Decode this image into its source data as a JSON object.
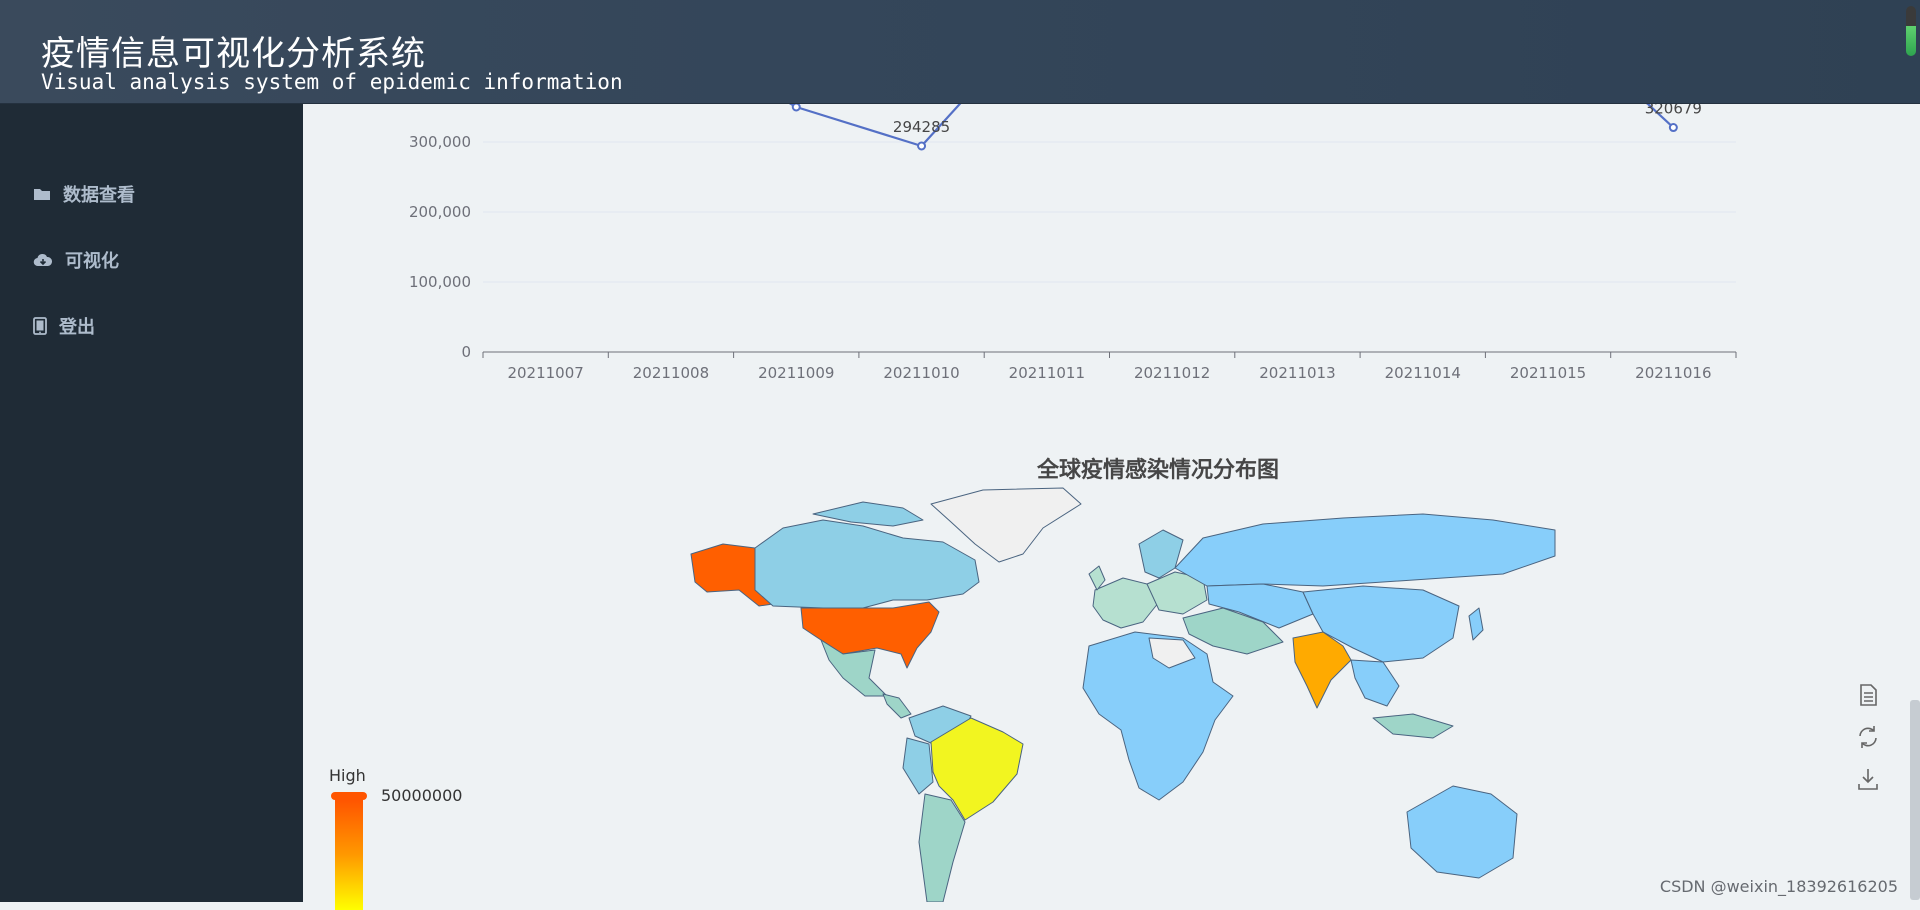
{
  "header": {
    "title": "疫情信息可视化分析系统",
    "subtitle": "Visual analysis system of epidemic information"
  },
  "sidebar": {
    "items": [
      {
        "label": "数据查看",
        "icon": "folder-icon"
      },
      {
        "label": "可视化",
        "icon": "cloud-download-icon"
      },
      {
        "label": "登出",
        "icon": "tablet-icon"
      }
    ]
  },
  "line_chart": {
    "chart_data": {
      "type": "line",
      "x": [
        "20211007",
        "20211008",
        "20211009",
        "20211010",
        "20211011",
        "20211012",
        "20211013",
        "20211014",
        "20211015",
        "20211016"
      ],
      "series": [
        {
          "values": [
            null,
            null,
            350000,
            294285,
            null,
            null,
            null,
            null,
            null,
            320679
          ]
        }
      ],
      "data_labels": {
        "20211010": "294285",
        "20211016": "320679"
      },
      "yticks": [
        "0",
        "100,000",
        "200,000",
        "300,000"
      ],
      "ylim": [
        0,
        330000
      ],
      "colors": {
        "line": "#5470c6"
      }
    }
  },
  "map": {
    "title": "全球疫情感染情况分布图",
    "legend": {
      "high_label": "High",
      "max_value": "50000000"
    },
    "colors": {
      "high": "#ff5500",
      "mid": "#ffaa00",
      "low": "#eaf522",
      "base": "#87cefa",
      "teal": "#9ed5c8",
      "none": "#f0f0f0"
    }
  },
  "toolbox": [
    {
      "name": "data-view-icon"
    },
    {
      "name": "restore-icon"
    },
    {
      "name": "save-image-icon"
    }
  ],
  "watermark": "CSDN @weixin_18392616205"
}
